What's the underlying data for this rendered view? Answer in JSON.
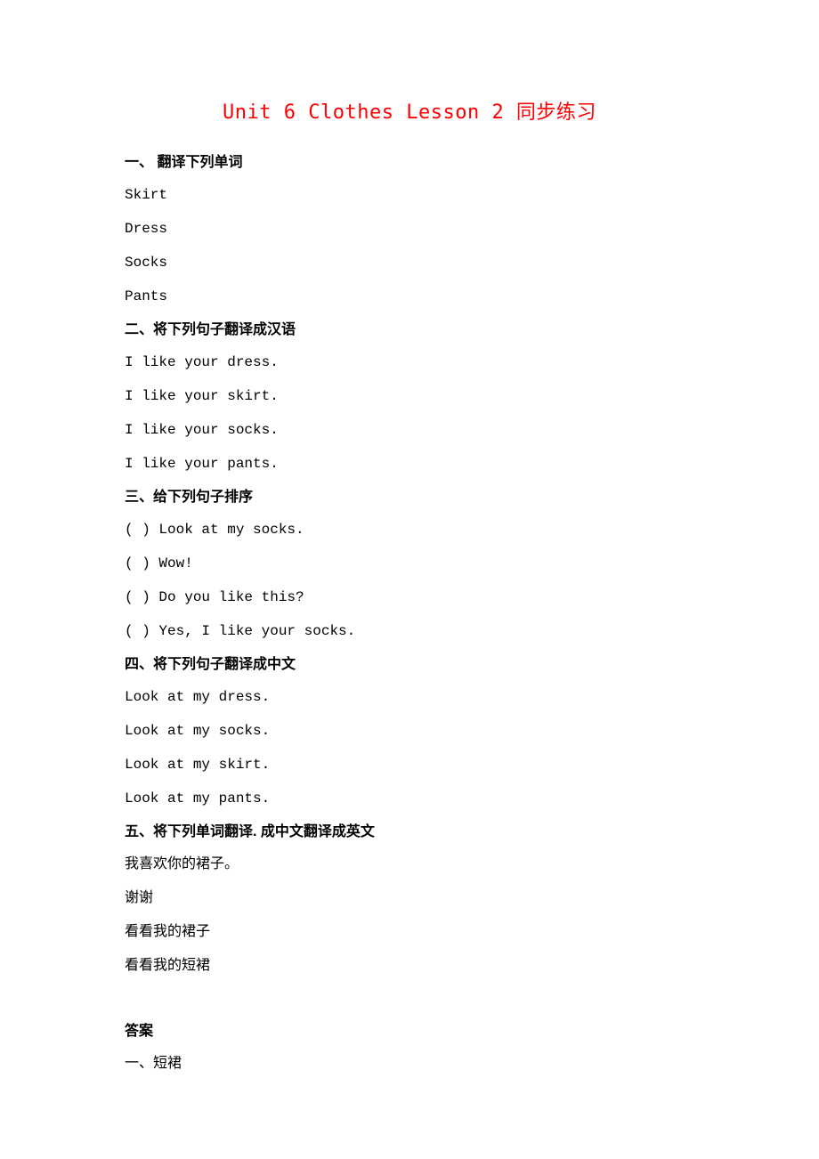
{
  "title": "Unit 6 Clothes Lesson 2 同步练习",
  "sections": {
    "s1": {
      "heading": "一、  翻译下列单词",
      "items": [
        "Skirt",
        "Dress",
        "Socks",
        "Pants"
      ]
    },
    "s2": {
      "heading": "二、将下列句子翻译成汉语",
      "items": [
        "I like your dress.",
        "I like your skirt.",
        "I like your socks.",
        "I like your pants."
      ]
    },
    "s3": {
      "heading": "三、给下列句子排序",
      "items": [
        "( ) Look at my socks.",
        "( ) Wow!",
        "( ) Do you like this?",
        "( ) Yes, I like your socks."
      ]
    },
    "s4": {
      "heading": "四、将下列句子翻译成中文",
      "items": [
        "Look at my dress.",
        "Look at my socks.",
        "Look at my skirt.",
        "Look at my pants."
      ]
    },
    "s5": {
      "heading": "五、将下列单词翻译. 成中文翻译成英文",
      "items": [
        "我喜欢你的裙子。",
        "谢谢",
        "看看我的裙子",
        "看看我的短裙"
      ]
    },
    "answers": {
      "heading": "答案",
      "items": [
        "一、短裙"
      ]
    }
  }
}
